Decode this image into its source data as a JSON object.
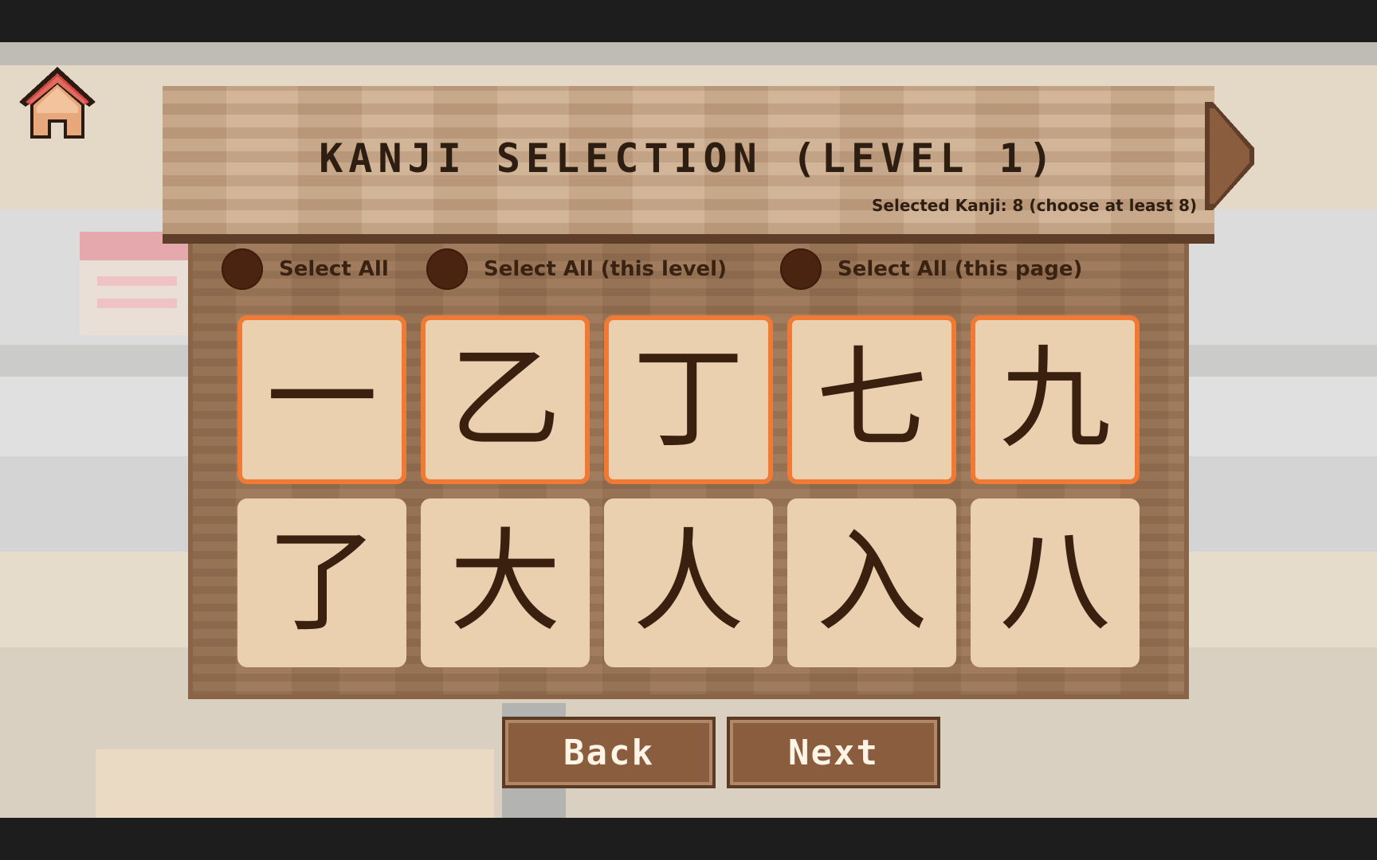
{
  "header": {
    "title": "KANJI SELECTION (LEVEL 1)",
    "selected_count": "Selected Kanji: 8 (choose at least 8)"
  },
  "select_options": [
    {
      "label": "Select All"
    },
    {
      "label": "Select All (this level)"
    },
    {
      "label": "Select All (this page)"
    }
  ],
  "kanji_tiles": [
    {
      "char": "一",
      "selected": true
    },
    {
      "char": "乙",
      "selected": true
    },
    {
      "char": "丁",
      "selected": true
    },
    {
      "char": "七",
      "selected": true
    },
    {
      "char": "九",
      "selected": true
    },
    {
      "char": "了",
      "selected": false
    },
    {
      "char": "大",
      "selected": false
    },
    {
      "char": "人",
      "selected": false
    },
    {
      "char": "入",
      "selected": false
    },
    {
      "char": "八",
      "selected": false
    }
  ],
  "buttons": {
    "back_label": "Back",
    "next_label": "Next"
  },
  "icons": {
    "home": "home-icon",
    "next_page": "arrow-right-icon"
  },
  "colors": {
    "selected_border": "#f07a34",
    "tile_bg": "#ead0ae",
    "panel": "#9a7354",
    "radio": "#4a2410"
  }
}
